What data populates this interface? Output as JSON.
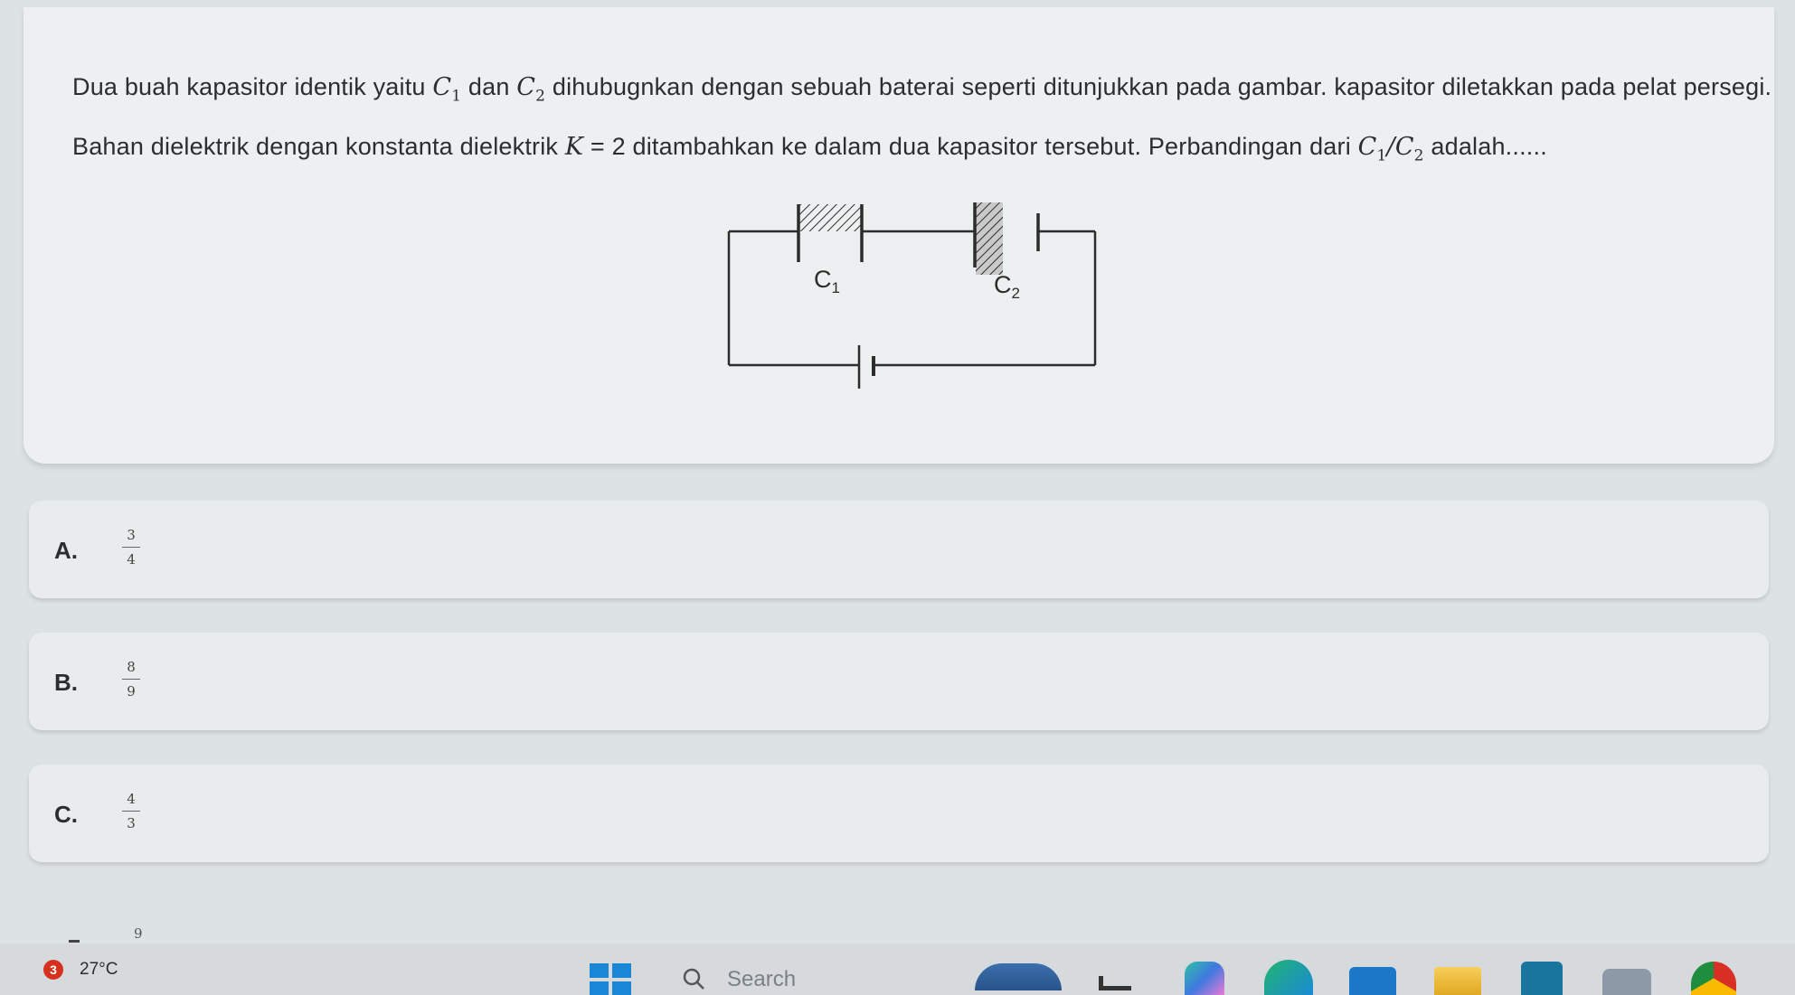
{
  "question": {
    "text_part1": "Dua buah kapasitor identik yaitu ",
    "c1": "C",
    "c1_sub": "1",
    "text_part2": " dan ",
    "c2": "C",
    "c2_sub": "2",
    "text_part3": " dihubugnkan dengan sebuah baterai seperti ditunjukkan pada gambar. kapasitor diletakkan pada pelat persegi. Bahan dielektrik dengan konstanta dielektrik ",
    "k_var": "K",
    "k_eq": " = 2",
    "text_part4": " ditambahkan ke dalam dua kapasitor tersebut. Perbandingan dari ",
    "ratio_c1": "C",
    "ratio_c1_sub": "1",
    "ratio_slash": "/",
    "ratio_c2": "C",
    "ratio_c2_sub": "2",
    "text_part5": " adalah......"
  },
  "circuit": {
    "c1_label": "C",
    "c1_sub": "1",
    "c2_label": "C",
    "c2_sub": "2"
  },
  "options": [
    {
      "letter": "A.",
      "numerator": "3",
      "denominator": "4"
    },
    {
      "letter": "B.",
      "numerator": "8",
      "denominator": "9"
    },
    {
      "letter": "C.",
      "numerator": "4",
      "denominator": "3"
    }
  ],
  "partial_option": {
    "digit": "9"
  },
  "taskbar": {
    "weather_badge": "3",
    "temperature": "27°C",
    "search_label": "Search",
    "apps": [
      "weather-app-icon",
      "file-explorer-icon",
      "copilot-icon",
      "edge-icon",
      "store-icon",
      "folder-icon",
      "classroom-icon",
      "camera-icon",
      "chrome-icon"
    ],
    "accent": "#1a86d6"
  }
}
